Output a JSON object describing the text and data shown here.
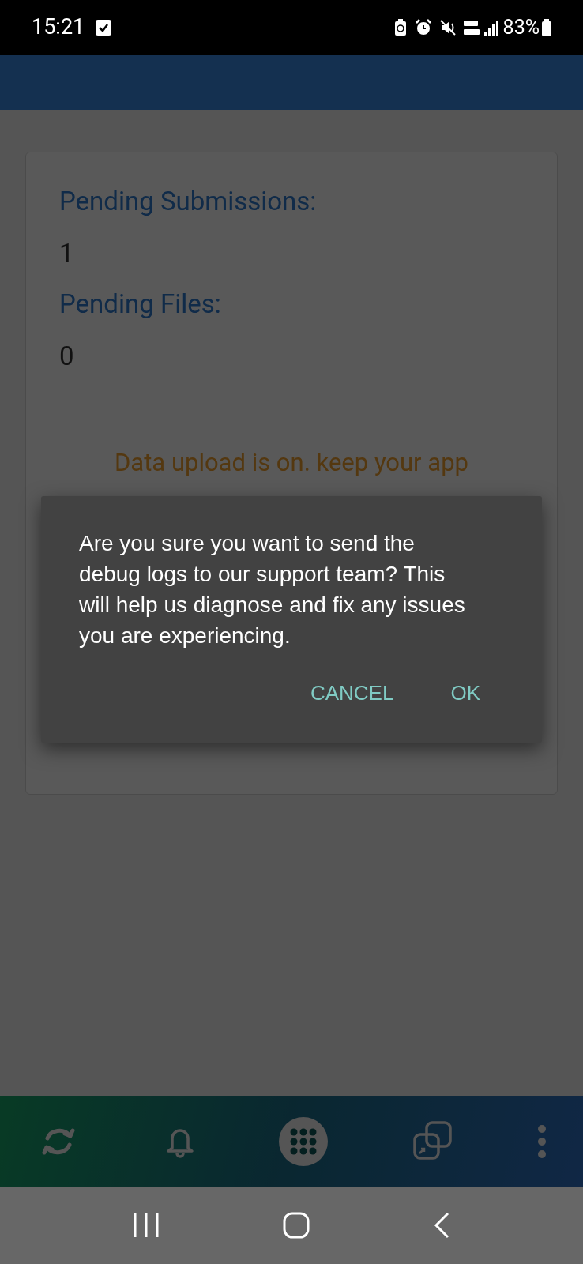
{
  "status_bar": {
    "time": "15:21",
    "battery": "83%"
  },
  "card": {
    "fields": [
      {
        "label": "Pending Submissions:",
        "value": "1"
      },
      {
        "label": "Pending Files:",
        "value": "0"
      }
    ],
    "notice": "Data upload is on. keep your app"
  },
  "bottom_nav": [
    {
      "kind": "sync",
      "selected": false
    },
    {
      "kind": "bell",
      "selected": false
    },
    {
      "kind": "grid",
      "selected": true
    },
    {
      "kind": "windows",
      "selected": false
    },
    {
      "kind": "more",
      "selected": false
    }
  ],
  "dialog": {
    "message": "Are you sure you want to send the debug logs to our support team? This will help us diagnose and fix any issues you are experiencing.",
    "buttons": [
      "CANCEL",
      "OK"
    ]
  }
}
